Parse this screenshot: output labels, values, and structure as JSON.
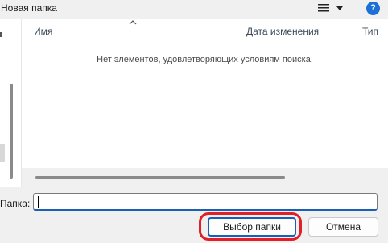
{
  "toolbar": {
    "new_folder_label": "Новая папка",
    "view_icon": "list-view-icon",
    "view_dropdown_icon": "chevron-down-icon",
    "help_icon": "help-icon",
    "help_glyph": "?"
  },
  "file_list": {
    "columns": [
      "Имя",
      "Дата изменения",
      "Тип"
    ],
    "sort_indicator_icon": "sort-up-caret-icon",
    "empty_message": "Нет элементов, удовлетворяющих условиям поиска."
  },
  "folder_field": {
    "label": "Папка:",
    "value": ""
  },
  "buttons": {
    "select_folder": "Выбор папки",
    "cancel": "Отмена"
  },
  "colors": {
    "accent": "#1a5fb4",
    "highlight_ring": "#e01f26",
    "help_icon": "#1c6fd6"
  }
}
